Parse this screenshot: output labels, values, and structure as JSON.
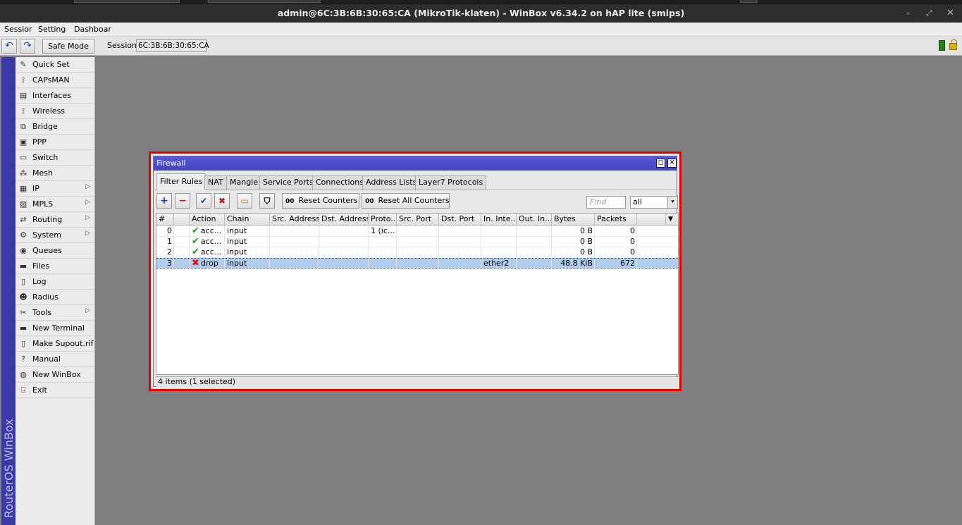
{
  "window": {
    "title": "admin@6C:3B:6B:30:65:CA (MikroTik-klaten) - WinBox v6.34.2 on hAP lite (smips)",
    "minimize_glyph": "–",
    "restore_glyph": "⤢",
    "close_glyph": "✕"
  },
  "menu": {
    "session": "Sessior",
    "settings": "Setting",
    "dashboard": "Dashboar"
  },
  "toolbar": {
    "undo": "↶",
    "redo": "↷",
    "safe_mode": "Safe Mode",
    "session_label": "Session",
    "session_value": "6C:3B:6B:30:65:CA"
  },
  "branding": {
    "vertical_text": "RouterOS WinBox"
  },
  "sidebar": {
    "items": [
      {
        "label": "Quick Set",
        "icon": "quick-set-icon",
        "glyph": "✎",
        "submenu": false
      },
      {
        "label": "CAPsMAN",
        "icon": "capsman-icon",
        "glyph": "⟟",
        "submenu": false
      },
      {
        "label": "Interfaces",
        "icon": "interfaces-icon",
        "glyph": "▤",
        "submenu": false
      },
      {
        "label": "Wireless",
        "icon": "wireless-icon",
        "glyph": "⟟",
        "submenu": false
      },
      {
        "label": "Bridge",
        "icon": "bridge-icon",
        "glyph": "⧉",
        "submenu": false
      },
      {
        "label": "PPP",
        "icon": "ppp-icon",
        "glyph": "▣",
        "submenu": false
      },
      {
        "label": "Switch",
        "icon": "switch-icon",
        "glyph": "▭",
        "submenu": false
      },
      {
        "label": "Mesh",
        "icon": "mesh-icon",
        "glyph": "⁂",
        "submenu": false
      },
      {
        "label": "IP",
        "icon": "ip-icon",
        "glyph": "▦",
        "submenu": true
      },
      {
        "label": "MPLS",
        "icon": "mpls-icon",
        "glyph": "▨",
        "submenu": true
      },
      {
        "label": "Routing",
        "icon": "routing-icon",
        "glyph": "⇄",
        "submenu": true
      },
      {
        "label": "System",
        "icon": "system-gear-icon",
        "glyph": "⚙",
        "submenu": true
      },
      {
        "label": "Queues",
        "icon": "queues-icon",
        "glyph": "◉",
        "submenu": false
      },
      {
        "label": "Files",
        "icon": "files-folder-icon",
        "glyph": "▬",
        "submenu": false
      },
      {
        "label": "Log",
        "icon": "log-icon",
        "glyph": "▯",
        "submenu": false
      },
      {
        "label": "Radius",
        "icon": "radius-users-icon",
        "glyph": "☻",
        "submenu": false
      },
      {
        "label": "Tools",
        "icon": "tools-icon",
        "glyph": "✂",
        "submenu": true
      },
      {
        "label": "New Terminal",
        "icon": "terminal-icon",
        "glyph": "▬",
        "submenu": false
      },
      {
        "label": "Make Supout.rif",
        "icon": "supout-icon",
        "glyph": "▯",
        "submenu": false
      },
      {
        "label": "Manual",
        "icon": "manual-help-icon",
        "glyph": "?",
        "submenu": false
      },
      {
        "label": "New WinBox",
        "icon": "winbox-globe-icon",
        "glyph": "◍",
        "submenu": false
      },
      {
        "label": "Exit",
        "icon": "exit-icon",
        "glyph": "⍈",
        "submenu": false
      }
    ],
    "submenu_arrow": "▷"
  },
  "firewall": {
    "title": "Firewall",
    "restore_glyph": "◻",
    "close_glyph": "✕",
    "tabs": [
      "Filter Rules",
      "NAT",
      "Mangle",
      "Service Ports",
      "Connections",
      "Address Lists",
      "Layer7 Protocols"
    ],
    "toolbar": {
      "add": "+",
      "remove": "−",
      "enable": "✔",
      "disable": "✖",
      "comment": "▭",
      "filter": "⛉",
      "reset_counters": "Reset Counters",
      "reset_all_counters": "Reset All Counters",
      "counter_glyph": "00",
      "find_placeholder": "Find",
      "filter_value": "all",
      "dropdown_glyph": "⯆"
    },
    "columns": [
      "#",
      "",
      "Action",
      "Chain",
      "Src. Address",
      "Dst. Address",
      "Proto...",
      "Src. Port",
      "Dst. Port",
      "In. Inte...",
      "Out. In...",
      "Bytes",
      "Packets"
    ],
    "column_menu_glyph": "▼",
    "rows": [
      {
        "num": "0",
        "action": "acc...",
        "status": "accept",
        "glyph": "✔",
        "chain": "input",
        "src": "",
        "dst": "",
        "proto": "1 (ic...",
        "sport": "",
        "dport": "",
        "in_if": "",
        "out_if": "",
        "bytes": "0 B",
        "packets": "0",
        "selected": false
      },
      {
        "num": "1",
        "action": "acc...",
        "status": "accept",
        "glyph": "✔",
        "chain": "input",
        "src": "",
        "dst": "",
        "proto": "",
        "sport": "",
        "dport": "",
        "in_if": "",
        "out_if": "",
        "bytes": "0 B",
        "packets": "0",
        "selected": false
      },
      {
        "num": "2",
        "action": "acc...",
        "status": "accept",
        "glyph": "✔",
        "chain": "input",
        "src": "",
        "dst": "",
        "proto": "",
        "sport": "",
        "dport": "",
        "in_if": "",
        "out_if": "",
        "bytes": "0 B",
        "packets": "0",
        "selected": false
      },
      {
        "num": "3",
        "action": "drop",
        "status": "drop",
        "glyph": "✖",
        "chain": "input",
        "src": "",
        "dst": "",
        "proto": "",
        "sport": "",
        "dport": "",
        "in_if": "ether2",
        "out_if": "",
        "bytes": "48.8 KiB",
        "packets": "672",
        "selected": true
      }
    ],
    "status": "4 items (1 selected)"
  }
}
